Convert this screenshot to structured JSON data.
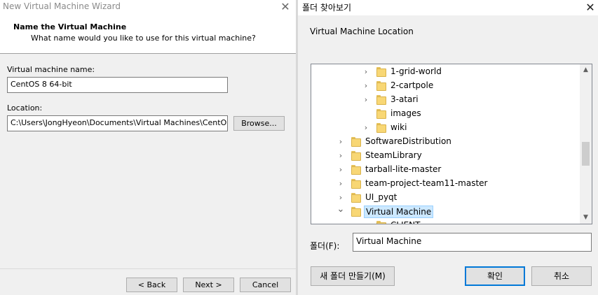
{
  "wizard": {
    "title": "New Virtual Machine Wizard",
    "header_title": "Name the Virtual Machine",
    "header_subtitle": "What name would you like to use for this virtual machine?",
    "vm_name_label": "Virtual machine name:",
    "vm_name_value": "CentOS 8 64-bit",
    "location_label": "Location:",
    "location_value": "C:\\Users\\JongHyeon\\Documents\\Virtual Machines\\CentO",
    "browse_label": "Browse...",
    "back_label": "< Back",
    "next_label": "Next >",
    "cancel_label": "Cancel"
  },
  "browse_dialog": {
    "title": "폴더 찾아보기",
    "description": "Virtual Machine Location",
    "tree": [
      {
        "label": "1-grid-world",
        "level": 1,
        "expandable": true
      },
      {
        "label": "2-cartpole",
        "level": 1,
        "expandable": true
      },
      {
        "label": "3-atari",
        "level": 1,
        "expandable": true
      },
      {
        "label": "images",
        "level": 1,
        "expandable": false
      },
      {
        "label": "wiki",
        "level": 1,
        "expandable": true
      },
      {
        "label": "SoftwareDistribution",
        "level": 0,
        "expandable": true
      },
      {
        "label": "SteamLibrary",
        "level": 0,
        "expandable": true
      },
      {
        "label": "tarball-lite-master",
        "level": 0,
        "expandable": true
      },
      {
        "label": "team-project-team11-master",
        "level": 0,
        "expandable": true
      },
      {
        "label": "UI_pyqt",
        "level": 0,
        "expandable": true
      },
      {
        "label": "Virtual Machine",
        "level": 0,
        "expandable": true,
        "expanded": true,
        "selected": true
      },
      {
        "label": "CLIENT",
        "level": 1,
        "expandable": false
      }
    ],
    "folder_label": "폴더(F):",
    "folder_value": "Virtual Machine",
    "new_folder_label": "새 폴더 만들기(M)",
    "ok_label": "확인",
    "cancel_label": "취소"
  },
  "icons": {
    "close": "close-icon",
    "folder": "folder-icon",
    "chevron_right": "chevron-right-icon",
    "chevron_down": "chevron-down-icon",
    "scroll_up": "scroll-up-icon",
    "scroll_down": "scroll-down-icon"
  },
  "colors": {
    "selection_bg": "#cce8ff",
    "selection_border": "#99d1ff",
    "focus_border": "#0078d7",
    "folder_fill": "#f8d775"
  }
}
